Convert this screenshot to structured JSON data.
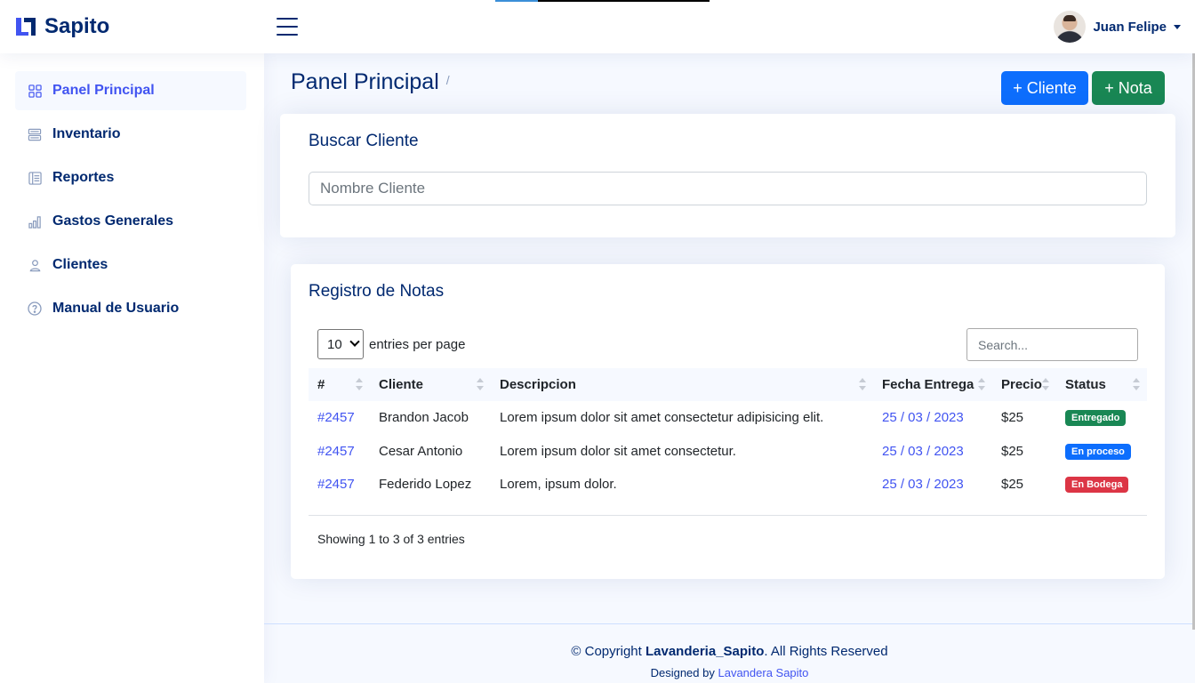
{
  "app": {
    "brand": "Sapito",
    "accent_color": "#4154f1",
    "primary_text_color": "#012970"
  },
  "header": {
    "menu_icon": "hamburger-icon",
    "user_name": "Juan Felipe"
  },
  "sidebar": {
    "items": [
      {
        "label": "Panel Principal",
        "icon": "grid-icon",
        "active": true
      },
      {
        "label": "Inventario",
        "icon": "layout-list-icon",
        "active": false
      },
      {
        "label": "Reportes",
        "icon": "layout-text-sidebar-icon",
        "active": false
      },
      {
        "label": "Gastos Generales",
        "icon": "bar-chart-icon",
        "active": false
      },
      {
        "label": "Clientes",
        "icon": "person-icon",
        "active": false
      },
      {
        "label": "Manual de Usuario",
        "icon": "question-circle-icon",
        "active": false
      }
    ]
  },
  "page": {
    "title": "Panel Principal",
    "breadcrumb_separator": "/",
    "btn_cliente": "+ Cliente",
    "btn_nota": "+ Nota",
    "btn_cliente_color": "#0d6efd",
    "btn_nota_color": "#198754"
  },
  "search_card": {
    "title": "Buscar Cliente",
    "placeholder": "Nombre Cliente"
  },
  "notes_card": {
    "title": "Registro de Notas",
    "entries_value": "10",
    "entries_label": "entries per page",
    "search_placeholder": "Search...",
    "columns": [
      "#",
      "Cliente",
      "Descripcion",
      "Fecha Entrega",
      "Precio",
      "Status"
    ],
    "rows": [
      {
        "id": "#2457",
        "cliente": "Brandon Jacob",
        "descripcion": "Lorem ipsum dolor sit amet consectetur adipisicing elit.",
        "fecha": "25 / 03 / 2023",
        "precio": "$25",
        "status": "Entregado",
        "status_color": "#198754"
      },
      {
        "id": "#2457",
        "cliente": "Cesar Antonio",
        "descripcion": "Lorem ipsum dolor sit amet consectetur.",
        "fecha": "25 / 03 / 2023",
        "precio": "$25",
        "status": "En proceso",
        "status_color": "#0d6efd"
      },
      {
        "id": "#2457",
        "cliente": "Federido Lopez",
        "descripcion": "Lorem, ipsum dolor.",
        "fecha": "25 / 03 / 2023",
        "precio": "$25",
        "status": "En Bodega",
        "status_color": "#dc3545"
      }
    ],
    "info": "Showing 1 to 3 of 3 entries"
  },
  "footer": {
    "copy_prefix": "© Copyright",
    "copy_brand": "Lavanderia_Sapito",
    "copy_suffix": ". All Rights Reserved",
    "credits_prefix": "Designed by",
    "credits_link": "Lavandera Sapito"
  }
}
